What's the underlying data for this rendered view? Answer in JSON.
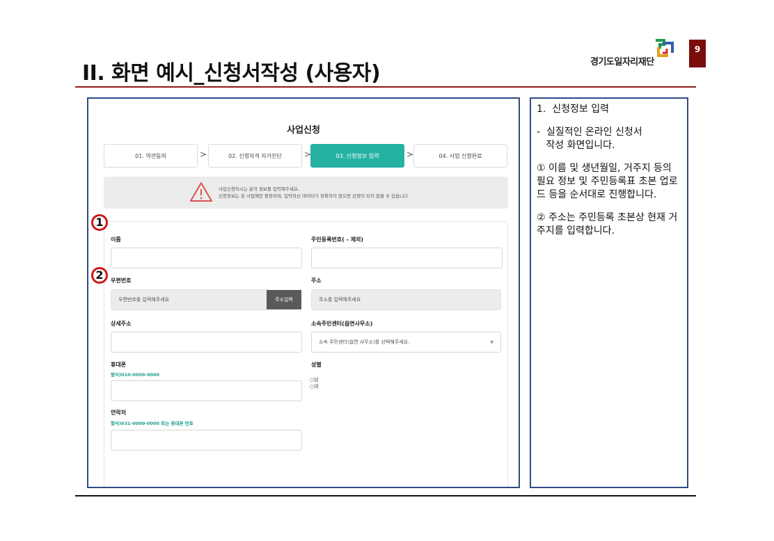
{
  "slide": {
    "title": "II. 화면 예시_신청서작성 (사용자)",
    "page_number": "9",
    "logo_text": "경기도일자리재단"
  },
  "form": {
    "title": "사업신청",
    "steps": [
      {
        "label": "01. 약관동의",
        "active": false
      },
      {
        "label": "02. 신청자격 자가진단",
        "active": false
      },
      {
        "label": "03. 신청정보 입력",
        "active": true
      },
      {
        "label": "04. 사업 신청완료",
        "active": false
      }
    ],
    "notice": {
      "line1": "사업신청하시는 분의 정보를 입력해주세요.",
      "line2": "신청정보는 본 사업에만 활용되며, 입력하신 데이터가 정확하지 않으면 선정이 되지 않을 수 있습니다."
    },
    "markers": [
      "1",
      "2"
    ],
    "fields": {
      "name_label": "이름",
      "rrn_label": "주민등록번호( - 제외)",
      "zip_label": "우편번호",
      "zip_placeholder": "우편번호를 입력해주세요",
      "address_button": "주소입력",
      "address_label": "주소",
      "address_placeholder": "주소를 입력해주세요",
      "detail_label": "상세주소",
      "center_label": "소속주민센터(읍면사무소)",
      "center_placeholder": "소속 주민센터(읍면 사무소)를 선택해주세요.",
      "mobile_label": "휴대폰",
      "mobile_hint": "형식)010-0000-0000",
      "gender_label": "성별",
      "gender_options": [
        "○남",
        "○여"
      ],
      "phone_label": "연락처",
      "phone_hint": "형식)031-0000-0000 또는 휴대폰 번호"
    }
  },
  "description": {
    "heading": "1.  신청정보 입력",
    "intro": "-  실질적인 온라인 신청서\n   작성 화면입니다.",
    "point1": "① 이름 및 생년월일, 거주지 등의 필요 정보 및 주민등록표 초본 업로드 등을 순서대로 진행합니다.",
    "point2": "② 주소는 주민등록 초본상 현재 거주지를 입력합니다."
  },
  "colors": {
    "accent_teal": "#26b2a2",
    "frame_blue": "#2f4a86",
    "title_rule": "#8b1a1a",
    "marker_red": "#d01818"
  }
}
